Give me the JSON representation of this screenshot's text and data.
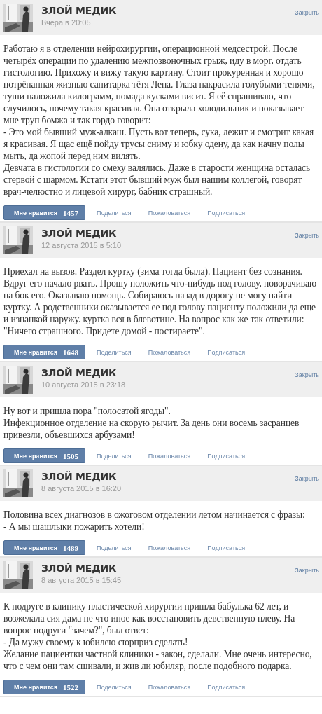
{
  "posts": [
    {
      "author": "ЗЛОЙ МЕДИК",
      "date": "Вчера в 20:05",
      "close": "Закрыть",
      "text": "Работаю я в отделении нейрохирургии, операционной медсестрой. После четырёх операции по удалению межпозвоночных грыж, иду в морг, отдать гистологию. Прихожу и вижу такую картину. Стоит прокуренная и хорошо потрёпанная жизнью санитарка тётя Лена. Глаза накрасила голубыми тенями, туши наложила килограмм, помада кусками висит. Я её спрашиваю, что случилось, почему такая красивая. Она открыла холодильник и показывает мне труп бомжа и так гордо говорит:\n- Это мой бывший муж-алкаш. Пусть вот теперь, сука, лежит и смотрит какая я красивая. Я щас ещё пойду трусы сниму и юбку одену, да как начну полы мыть, да жопой перед ним вилять.\nДевчата в гистологии со смеху валялись. Даже в старости женщина осталась стервой с шармом. Кстати этот бывший муж был нашим коллегой, говорят врач-челюстно и лицевой хирург, бабник страшный.",
      "like_label": "Мне нравится",
      "likes": "1457",
      "actions": [
        "Поделиться",
        "Пожаловаться",
        "Подписаться"
      ]
    },
    {
      "author": "ЗЛОЙ МЕДИК",
      "date": "12 августа 2015 в 5:10",
      "close": "Закрыть",
      "text": "Приехал на вызов. Раздел куртку (зима тогда была). Пациент без сознания. Вдруг его начало рвать. Прошу положить что-нибудь под голову, поворачиваю на бок его. Оказываю помощь. Собираюсь назад в дорогу не могу найти куртку. А родственники оказывается ее под голову пациенту положили да еще и изнанкой наружу. куртка вся в блевотине. На вопрос как же так ответили: \"Ничего страшного. Придете домой - постираете\".",
      "like_label": "Мне нравится",
      "likes": "1648",
      "actions": [
        "Поделиться",
        "Пожаловаться",
        "Подписаться"
      ]
    },
    {
      "author": "ЗЛОЙ МЕДИК",
      "date": "10 августа 2015 в 23:18",
      "close": "Закрыть",
      "text": "Ну вот и пришла пора \"полосатой ягоды\".\nИнфекционное отделение на скорую рычит. За день они восемь засранцев привезли, объевшихся арбузами!",
      "like_label": "Мне нравится",
      "likes": "1505",
      "actions": [
        "Поделиться",
        "Пожаловаться",
        "Подписаться"
      ]
    },
    {
      "author": "ЗЛОЙ МЕДИК",
      "date": "8 августа 2015 в 16:20",
      "close": "Закрыть",
      "text": "Половина всех диагнозов в ожоговом отделении летом начинается с фразы:\n- А мы шашлыки пожарить хотели!",
      "like_label": "Мне нравится",
      "likes": "1489",
      "actions": [
        "Поделиться",
        "Пожаловаться",
        "Подписаться"
      ]
    },
    {
      "author": "ЗЛОЙ МЕДИК",
      "date": "8 августа 2015 в 15:45",
      "close": "Закрыть",
      "text": "К подруге в клинику пластической хирургии пришла бабулька 62 лет, и возжелала сия дама не что иное как восстановить девственную плеву. На вопрос подруги \"зачем?\", был ответ:\n- Да мужу своему к юбилею сюрприз сделать!\nЖелание пациентки частной клиники - закон, сделали. Мне очень интересно, что с чем они там сшивали, и жив ли юбиляр, после подобного подарка.",
      "like_label": "Мне нравится",
      "likes": "1522",
      "actions": [
        "Поделиться",
        "Пожаловаться",
        "Подписаться"
      ]
    }
  ]
}
